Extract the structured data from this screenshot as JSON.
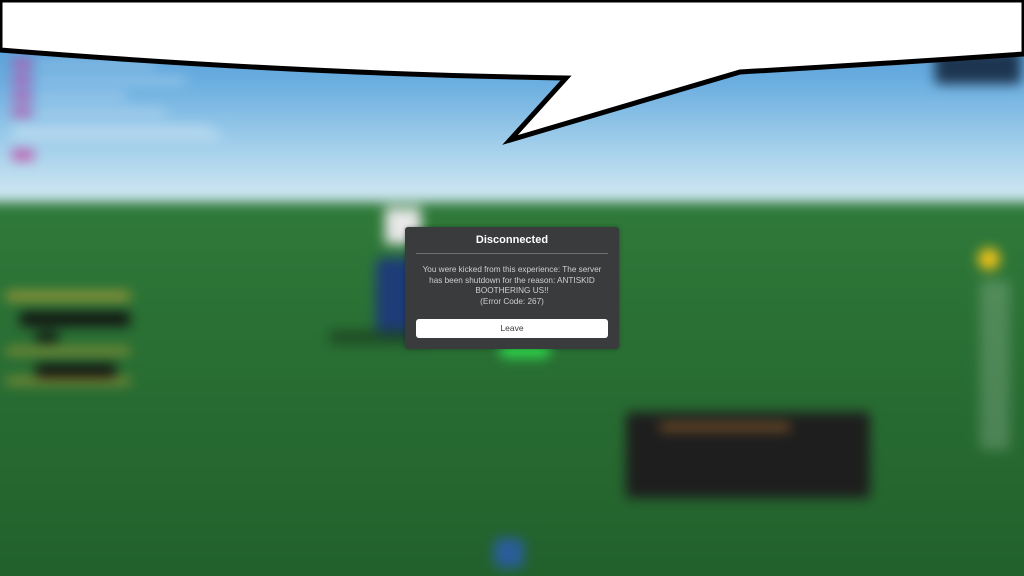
{
  "dialog": {
    "title": "Disconnected",
    "message_lines": [
      "You were kicked from this experience: The server",
      "has been shutdown for the reason: ANTISKID",
      "BOOTHERING US!!",
      "(Error Code: 267)"
    ],
    "leave_label": "Leave"
  },
  "colors": {
    "dialog_bg": "#393b3d",
    "button_bg": "#ffffff",
    "sky": "#6aaee0",
    "ground": "#2a7034"
  }
}
